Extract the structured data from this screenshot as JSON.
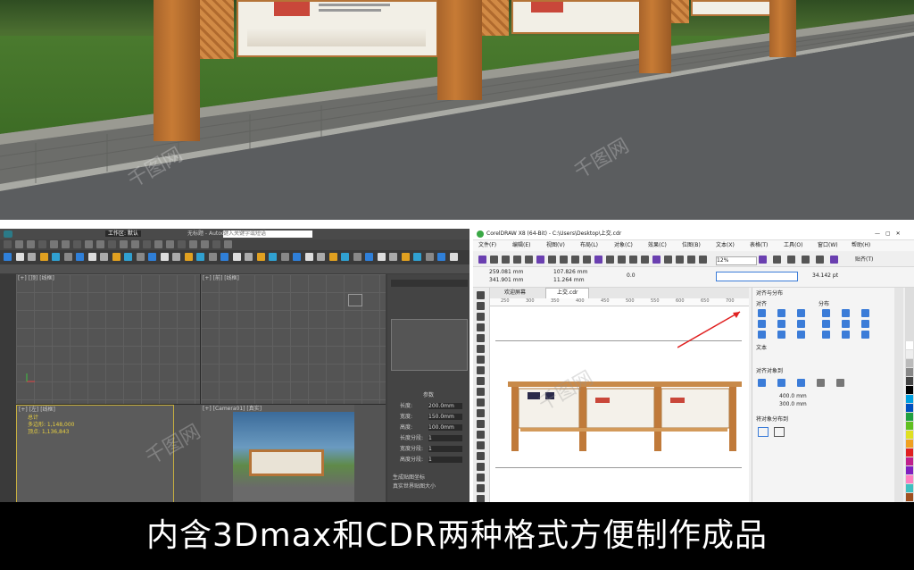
{
  "max": {
    "title": "无标题 - Autodesk 3ds Max",
    "workspace": "工作区: 默认",
    "search": "键入关键字或短语",
    "viewport_labels": [
      "[+] [顶] [线框]",
      "[+] [前] [线框]",
      "[+] [左] [线框]",
      "[+] [Camera01] [真实]"
    ],
    "stats": [
      "总计",
      "多边形: 1,148,000",
      "顶点: 1,136,843"
    ],
    "params_title": "参数",
    "param_labels": [
      "长度:",
      "宽度:",
      "高度:",
      "长度分段:",
      "宽度分段:",
      "高度分段:"
    ],
    "param_values": [
      "200.0mm",
      "150.0mm",
      "100.0mm",
      "1",
      "1",
      "1"
    ],
    "checkbox_labels": [
      "生成贴图坐标",
      "真实世界贴图大小"
    ]
  },
  "cdr": {
    "title": "CorelDRAW X8 (64-Bit) - C:\\Users\\Desktop\\上交.cdr",
    "menu": [
      "文件(F)",
      "编辑(E)",
      "视图(V)",
      "布局(L)",
      "对象(C)",
      "效果(C)",
      "位图(B)",
      "文本(X)",
      "表格(T)",
      "工具(O)",
      "窗口(W)",
      "帮助(H)"
    ],
    "zoom": "12%",
    "snap": "贴齐(T)",
    "x": "259.081 mm",
    "y": "341.901 mm",
    "w": "107.826 mm",
    "h": "11.264 mm",
    "rotation": "0.0",
    "font_size": "34.142 pt",
    "tabs": [
      "欢迎屏幕",
      "上交.cdr"
    ],
    "docker_title": "对齐与分布",
    "docker_sections": [
      "对齐",
      "分布",
      "文本",
      "对齐对象到",
      "将对象分布到"
    ],
    "docker_values": [
      "400.0 mm",
      "300.0 mm"
    ],
    "ruler_ticks": [
      "250",
      "300",
      "350",
      "400",
      "450",
      "500",
      "550",
      "600",
      "650",
      "700"
    ]
  },
  "watermark": "千图网",
  "caption": "内含3Dmax和CDR两种格式方便制作成品",
  "colors": {
    "max_bg": "#3d3d3d",
    "cdr_bg": "#f0f0f0",
    "caption_bg": "#000000",
    "wood": "#c27b3a",
    "grass": "#4a7a2e",
    "road": "#585a5c"
  }
}
